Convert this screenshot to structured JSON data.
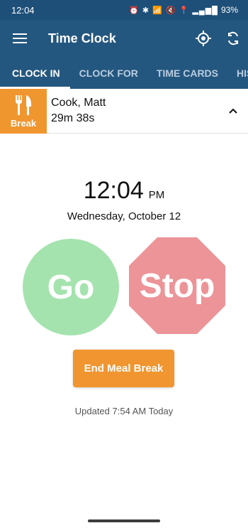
{
  "status_bar": {
    "time": "12:04",
    "battery": "93%",
    "icons": "⏰ ✱ 📶 🔇 📍 ▂▄▆█"
  },
  "app_bar": {
    "title": "Time Clock",
    "menu_icon": "hamburger-menu-icon",
    "location_icon": "location-target-icon",
    "refresh_icon": "sync-icon"
  },
  "tabs": [
    {
      "label": "CLOCK IN",
      "active": true
    },
    {
      "label": "CLOCK FOR",
      "active": false
    },
    {
      "label": "TIME CARDS",
      "active": false
    },
    {
      "label": "HIS",
      "active": false
    }
  ],
  "employee": {
    "name": "Cook, Matt",
    "duration": "29m 38s",
    "badge_label": "Break",
    "badge_icon": "fork-knife-icon"
  },
  "clock": {
    "time": "12:04",
    "ampm": "PM",
    "date": "Wednesday, October 12"
  },
  "actions": {
    "go_label": "Go",
    "stop_label": "Stop",
    "end_break_label": "End Meal Break"
  },
  "footer": {
    "updated": "Updated 7:54 AM Today"
  },
  "colors": {
    "appbar": "#24577f",
    "break": "#f0962f",
    "go": "#a4e3ae",
    "stop": "#ec9498"
  }
}
